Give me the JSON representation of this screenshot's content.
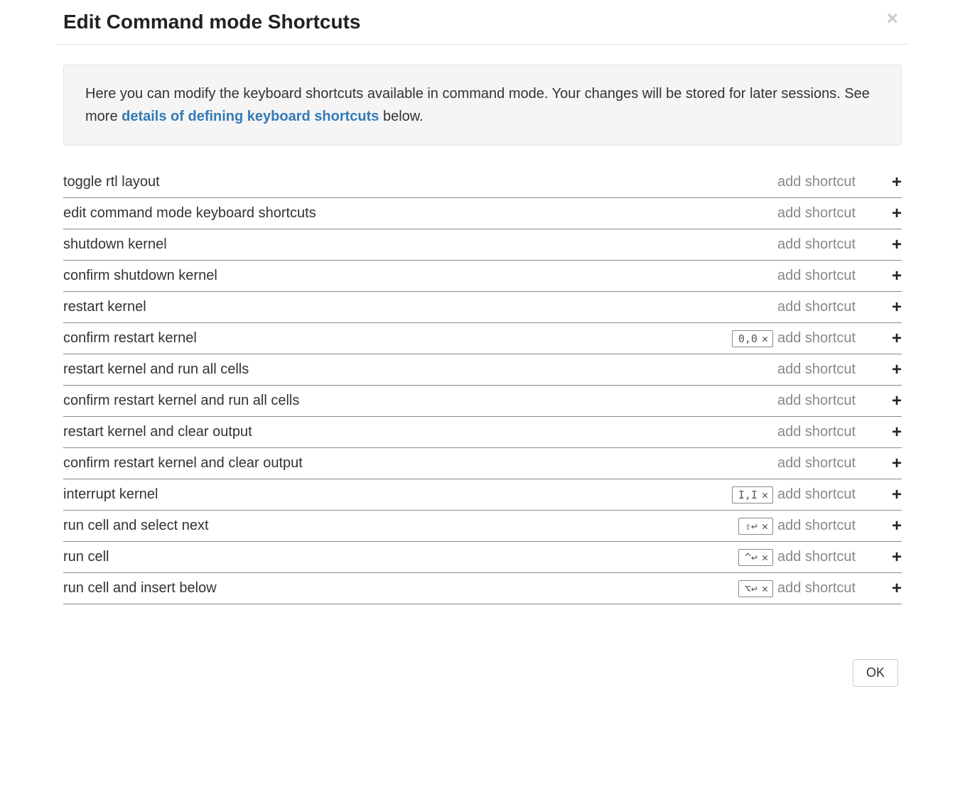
{
  "header": {
    "title": "Edit Command mode Shortcuts"
  },
  "info": {
    "text_before": "Here you can modify the keyboard shortcuts available in command mode. Your changes will be stored for later sessions. See more ",
    "link_text": "details of defining keyboard shortcuts",
    "text_after": " below."
  },
  "add_shortcut_placeholder": "add shortcut",
  "rows": [
    {
      "label": "toggle rtl layout",
      "chips": []
    },
    {
      "label": "edit command mode keyboard shortcuts",
      "chips": []
    },
    {
      "label": "shutdown kernel",
      "chips": []
    },
    {
      "label": "confirm shutdown kernel",
      "chips": []
    },
    {
      "label": "restart kernel",
      "chips": []
    },
    {
      "label": "confirm restart kernel",
      "chips": [
        "0,0"
      ]
    },
    {
      "label": "restart kernel and run all cells",
      "chips": []
    },
    {
      "label": "confirm restart kernel and run all cells",
      "chips": []
    },
    {
      "label": "restart kernel and clear output",
      "chips": []
    },
    {
      "label": "confirm restart kernel and clear output",
      "chips": []
    },
    {
      "label": "interrupt kernel",
      "chips": [
        "I,I"
      ]
    },
    {
      "label": "run cell and select next",
      "chips": [
        "⇧↩"
      ]
    },
    {
      "label": "run cell",
      "chips": [
        "^↩"
      ]
    },
    {
      "label": "run cell and insert below",
      "chips": [
        "⌥↩"
      ]
    }
  ],
  "footer": {
    "ok_label": "OK"
  }
}
